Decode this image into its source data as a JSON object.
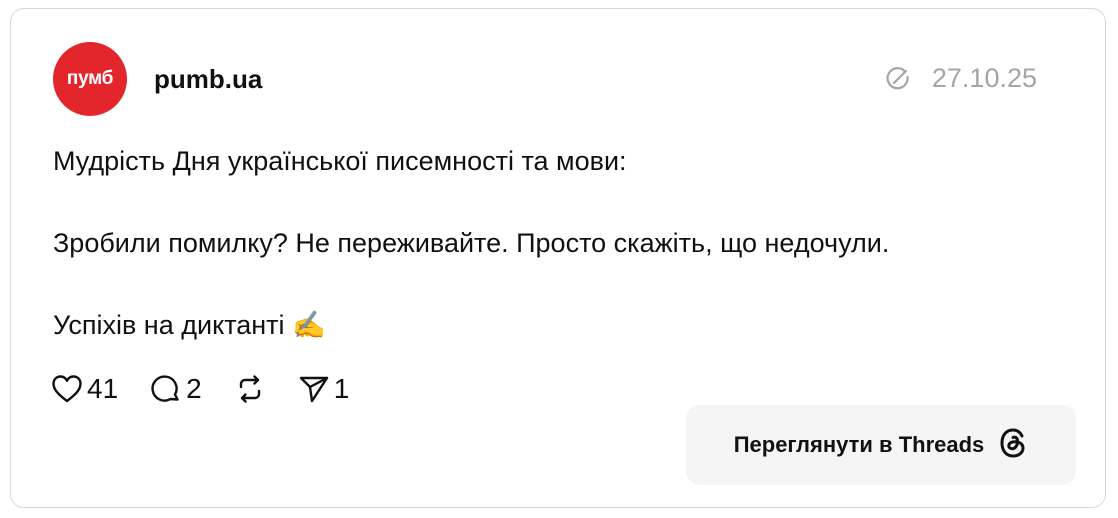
{
  "post": {
    "avatar_text": "пумб",
    "avatar_color": "#e3262c",
    "username": "pumb.ua",
    "date": "27.10.25",
    "lines": [
      "Мудрість Дня української писемності та мови:",
      "Зробили помилку? Не переживайте. Просто скажіть, що недочули.",
      "Успіхів на диктанті ✍️"
    ]
  },
  "actions": {
    "likes": "41",
    "replies": "2",
    "shares": "1"
  },
  "cta": {
    "label": "Переглянути в Threads"
  }
}
